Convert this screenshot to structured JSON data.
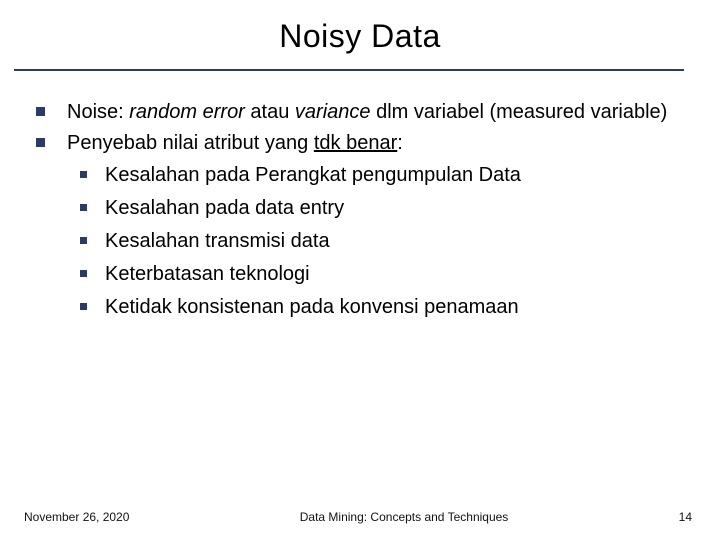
{
  "title": "Noisy Data",
  "body": {
    "p1_prefix": "Noise: ",
    "p1_it1": "random error",
    "p1_mid": " atau ",
    "p1_it2": "variance",
    "p1_suffix": " dlm variabel (measured variable)",
    "p2_prefix": "Penyebab nilai atribut yang ",
    "p2_under": "tdk benar",
    "p2_suffix": ":",
    "sub": [
      "Kesalahan pada Perangkat pengumpulan Data",
      "Kesalahan pada data entry",
      "Kesalahan transmisi data",
      "Keterbatasan teknologi",
      "Ketidak konsistenan pada konvensi penamaan"
    ]
  },
  "footer": {
    "date": "November 26, 2020",
    "center": "Data Mining: Concepts and Techniques",
    "page": "14"
  }
}
